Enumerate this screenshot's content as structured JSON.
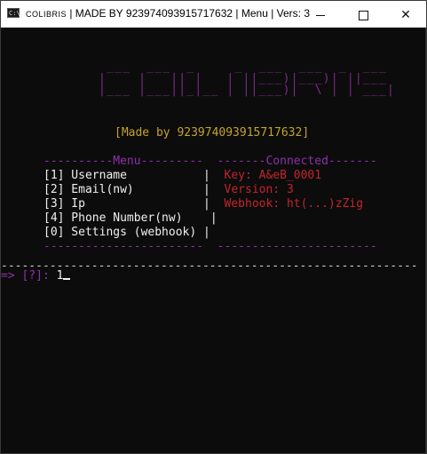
{
  "window": {
    "icon_label": "C:\\.",
    "title_brand": "COLIBRIS",
    "title_rest": " | MADE BY 923974093915717632 | Menu | Vers: 3",
    "min_label": "",
    "close_label": "✕"
  },
  "logo_art": " ___  ___  _     _  ___  ___  _  ___ \n|    |   || |   | ||___)|___)| ||___ \n|___ |___||_|__ | ||___)|  \\ | | ___|",
  "made_by": "[Made by 923974093915717632]",
  "menu": {
    "header_left": "----------Menu---------",
    "header_right": "-------Connected-------",
    "items": [
      {
        "label": "[1] Username",
        "sep": "|",
        "info": "Key: A&eB_0001"
      },
      {
        "label": "[2] Email(nw)",
        "sep": "|",
        "info": "Version: 3"
      },
      {
        "label": "[3] Ip",
        "sep": "|",
        "info": "Webhook: ht(...)zZig"
      },
      {
        "label": "[4] Phone Number(nw)",
        "sep": "|",
        "info": ""
      },
      {
        "label": "[0] Settings (webhook)",
        "sep": "|",
        "info": ""
      }
    ],
    "footer_left": "-----------------------",
    "footer_right": "-----------------------"
  },
  "separator": "------------------------------------------------------------",
  "prompt": {
    "arrow": "=> ",
    "label": "[?]",
    "colon": ": ",
    "input_value": "1"
  },
  "colors": {
    "background": "#0c0c0c",
    "purple": "#8f2fa8",
    "red": "#c3242b",
    "gold": "#c6a32b",
    "white": "#f0f0f0"
  }
}
